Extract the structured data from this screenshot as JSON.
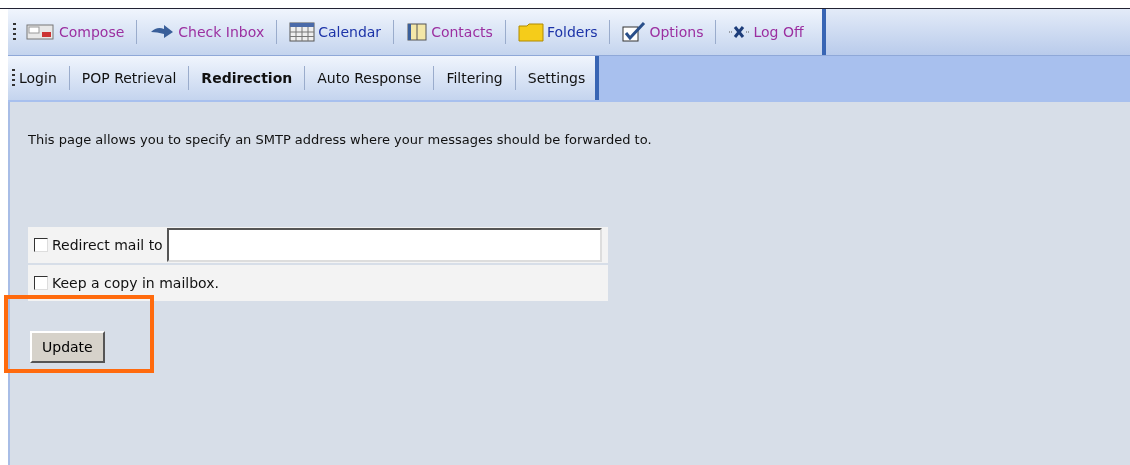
{
  "toolbar": [
    {
      "kind": "compose",
      "label": "Compose",
      "visited": true
    },
    {
      "kind": "inbox",
      "label": "Check Inbox",
      "visited": true
    },
    {
      "kind": "calendar",
      "label": "Calendar",
      "visited": false
    },
    {
      "kind": "contacts",
      "label": "Contacts",
      "visited": true
    },
    {
      "kind": "folders",
      "label": "Folders",
      "visited": false
    },
    {
      "kind": "options",
      "label": "Options",
      "visited": true
    },
    {
      "kind": "logoff",
      "label": "Log Off",
      "visited": true
    }
  ],
  "tabs": [
    {
      "label": "Login",
      "selected": false
    },
    {
      "label": "POP Retrieval",
      "selected": false
    },
    {
      "label": "Redirection",
      "selected": true
    },
    {
      "label": "Auto Response",
      "selected": false
    },
    {
      "label": "Filtering",
      "selected": false
    },
    {
      "label": "Settings",
      "selected": false
    }
  ],
  "description": "This page allows you to specify an SMTP address where your messages should be forwarded to.",
  "redirect": {
    "label": "Redirect mail to",
    "checked": false
  },
  "keep_copy": {
    "label": "Keep a copy in mailbox.",
    "checked": false
  },
  "update_button": {
    "label": "Update",
    "highlighted": true
  }
}
